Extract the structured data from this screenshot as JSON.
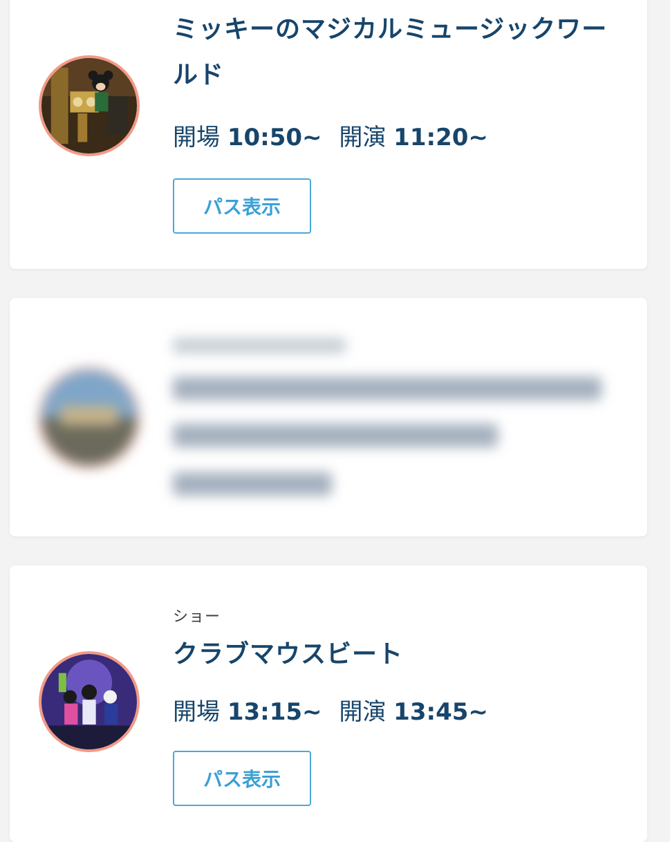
{
  "cards": [
    {
      "title": "ミッキーのマジカルミュージックワールド",
      "open_label": "開場",
      "open_time": "10:50~",
      "show_label": "開演",
      "show_time": "11:20~",
      "button_label": "パス表示"
    },
    {
      "blurred": true
    },
    {
      "category": "ショー",
      "title": "クラブマウスビート",
      "open_label": "開場",
      "open_time": "13:15~",
      "show_label": "開演",
      "show_time": "13:45~",
      "button_label": "パス表示"
    }
  ],
  "colors": {
    "title": "#17456b",
    "button": "#3aa0d5",
    "thumb_ring": "#f29a86",
    "background": "#f3f3f4"
  },
  "icons": [
    "show-thumbnail-image",
    "blurred-thumbnail-image"
  ]
}
